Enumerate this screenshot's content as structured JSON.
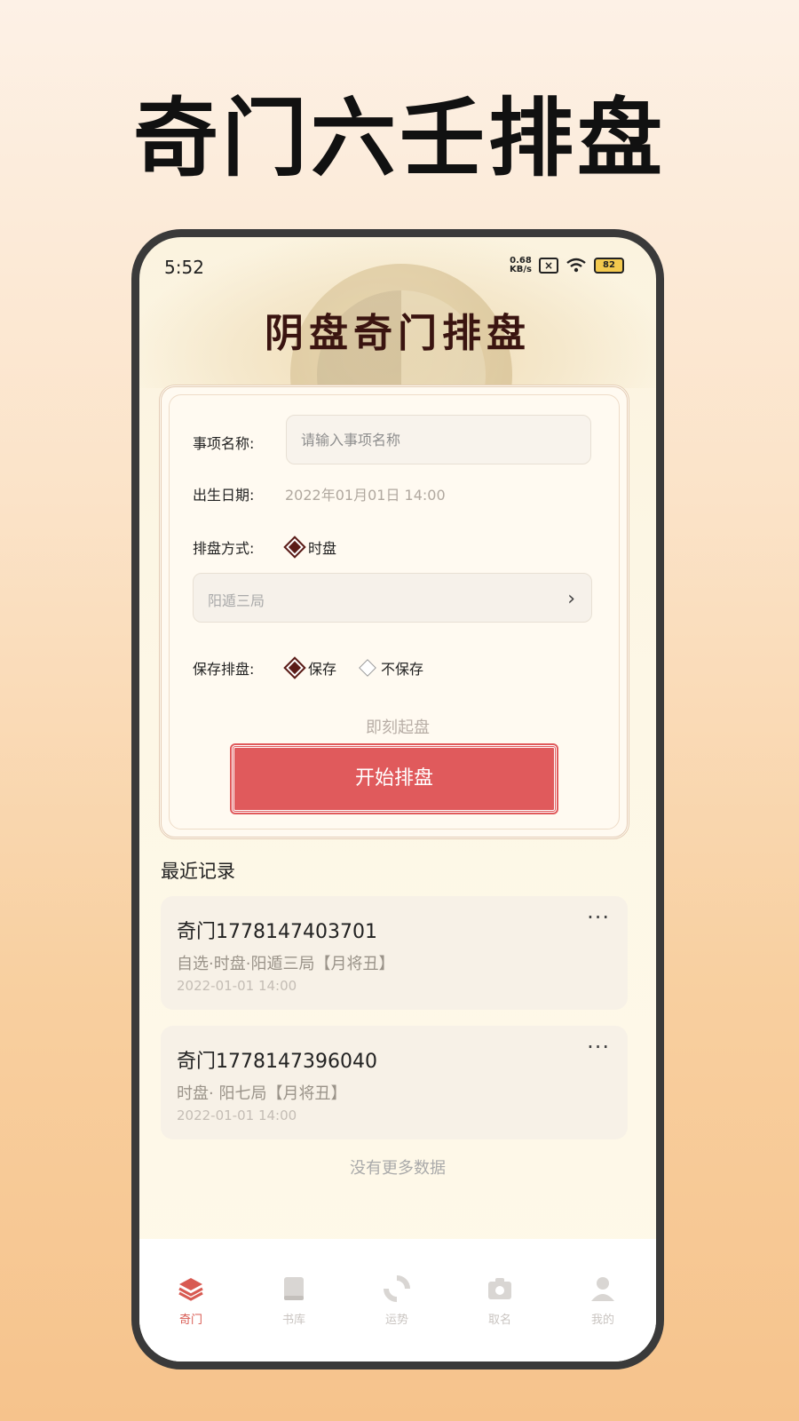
{
  "promo": {
    "title": "奇门六壬排盘"
  },
  "status_bar": {
    "time": "5:52",
    "net_speed_top": "0.68",
    "net_speed_bottom": "KB/s",
    "battery": "82"
  },
  "app": {
    "title": "阴盘奇门排盘"
  },
  "form": {
    "name_label": "事项名称:",
    "name_placeholder": "请输入事项名称",
    "date_label": "出生日期:",
    "date_value": "2022年01月01日 14:00",
    "method_label": "排盘方式:",
    "method_option": "时盘",
    "ju_select": "阳遁三局",
    "save_label": "保存排盘:",
    "save_options": [
      "保存",
      "不保存"
    ],
    "save_selected": "保存",
    "instant_label": "即刻起盘",
    "start_button": "开始排盘"
  },
  "recent": {
    "title": "最近记录",
    "items": [
      {
        "title": "奇门1778147403701",
        "desc": "自选·时盘·阳遁三局【月将丑】",
        "time": "2022-01-01 14:00"
      },
      {
        "title": "奇门1778147396040",
        "desc": "时盘· 阳七局【月将丑】",
        "time": "2022-01-01 14:00"
      }
    ],
    "more_icon": "···",
    "no_more": "没有更多数据"
  },
  "tabbar": {
    "tabs": [
      {
        "label": "奇门",
        "icon": "layers-icon",
        "active": true
      },
      {
        "label": "书库",
        "icon": "book-icon",
        "active": false
      },
      {
        "label": "运势",
        "icon": "refresh-icon",
        "active": false
      },
      {
        "label": "取名",
        "icon": "camera-icon",
        "active": false
      },
      {
        "label": "我的",
        "icon": "person-icon",
        "active": false
      }
    ]
  },
  "colors": {
    "accent": "#e05a5c",
    "active_tab": "#d85a52",
    "title_dark": "#3a1410"
  }
}
